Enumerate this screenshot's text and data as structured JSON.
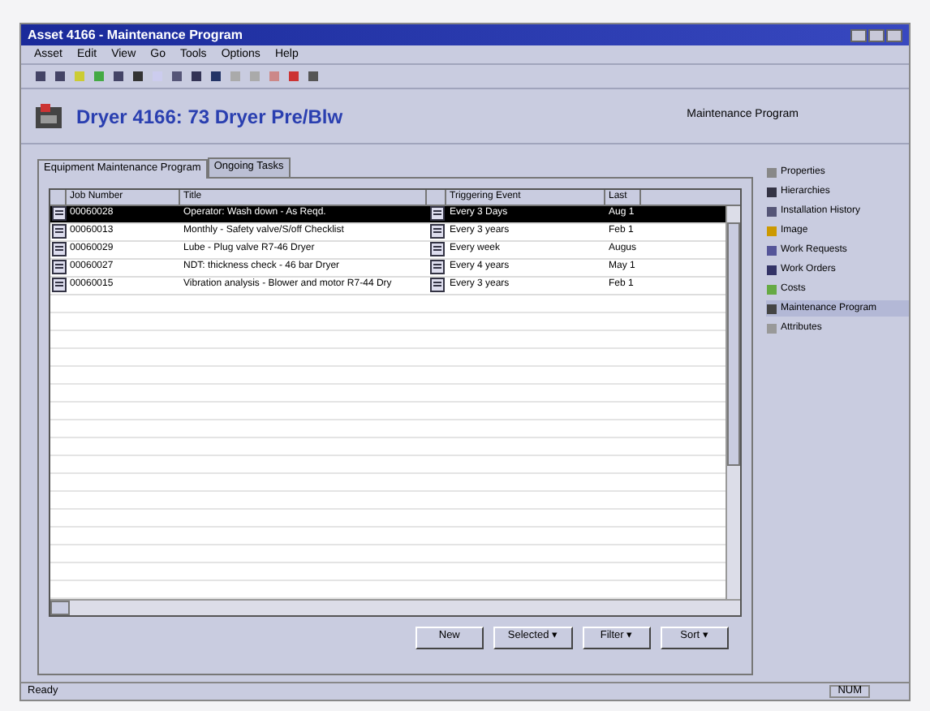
{
  "window": {
    "title": "Asset 4166 - Maintenance Program"
  },
  "menu": [
    "Asset",
    "Edit",
    "View",
    "Go",
    "Tools",
    "Options",
    "Help"
  ],
  "header": {
    "title": "Dryer 4166: 73 Dryer Pre/Blw",
    "section": "Maintenance Program"
  },
  "tabs": [
    {
      "label": "Equipment Maintenance Program",
      "selected": true
    },
    {
      "label": "Ongoing Tasks",
      "selected": false
    }
  ],
  "table": {
    "columns": [
      "Job Number",
      "Title",
      "",
      "Triggering Event",
      "Last"
    ],
    "rows": [
      {
        "job": "00060028",
        "title": "Operator: Wash down - As Reqd.",
        "event": "Every 3 Days",
        "last": "Aug 1",
        "selected": true
      },
      {
        "job": "00060013",
        "title": "Monthly - Safety valve/S/off Checklist",
        "event": "Every 3 years",
        "last": "Feb 1",
        "selected": false
      },
      {
        "job": "00060029",
        "title": "Lube - Plug valve R7-46 Dryer",
        "event": "Every week",
        "last": "Augus",
        "selected": false
      },
      {
        "job": "00060027",
        "title": "NDT: thickness check - 46 bar Dryer",
        "event": "Every 4 years",
        "last": "May 1",
        "selected": false
      },
      {
        "job": "00060015",
        "title": "Vibration analysis - Blower and motor R7-44 Dry",
        "event": "Every 3 years",
        "last": "Feb 1",
        "selected": false
      }
    ]
  },
  "buttons": [
    {
      "label": "New"
    },
    {
      "label": "Selected",
      "arrow": "▾"
    },
    {
      "label": "Filter",
      "arrow": "▾"
    },
    {
      "label": "Sort",
      "arrow": "▾"
    }
  ],
  "sidebar": {
    "items": [
      {
        "label": "Properties",
        "selected": false
      },
      {
        "label": "Hierarchies",
        "selected": false
      },
      {
        "label": "Installation History",
        "selected": false
      },
      {
        "label": "Image",
        "selected": false
      },
      {
        "label": "Work Requests",
        "selected": false
      },
      {
        "label": "Work Orders",
        "selected": false
      },
      {
        "label": "Costs",
        "selected": false
      },
      {
        "label": "Maintenance Program",
        "selected": true
      },
      {
        "label": "Attributes",
        "selected": false
      }
    ]
  },
  "status_bar": {
    "message": "Ready",
    "indicator": "NUM"
  }
}
